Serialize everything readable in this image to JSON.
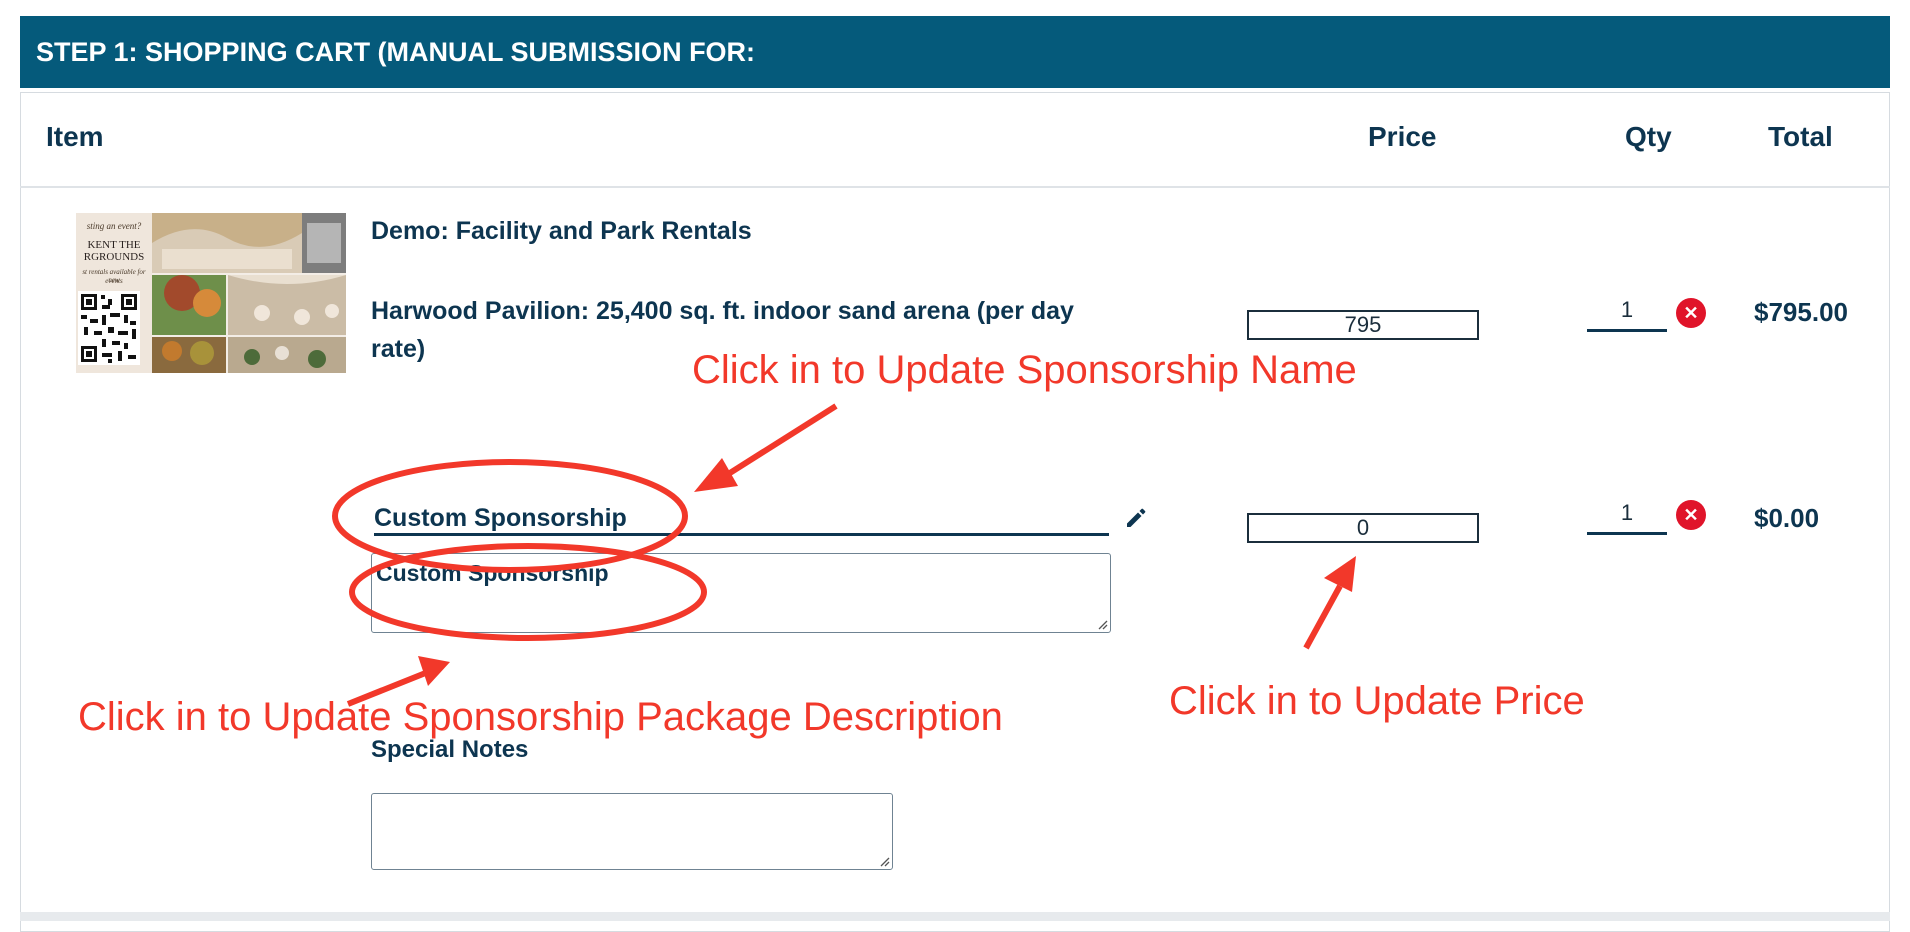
{
  "header": {
    "title": "STEP 1: SHOPPING CART (MANUAL SUBMISSION FOR:"
  },
  "table": {
    "columns": {
      "item": "Item",
      "price": "Price",
      "qty": "Qty",
      "total": "Total"
    }
  },
  "thumbnail": {
    "text_lines": [
      "sting an event?",
      "KENT THE",
      "RGROUNDS",
      "st rentals available for new",
      "events"
    ]
  },
  "cart": {
    "category": "Demo: Facility and Park Rentals",
    "item1": {
      "name": "Harwood Pavilion: 25,400 sq. ft. indoor sand arena (per day rate)",
      "price": "795",
      "qty": "1",
      "remove_icon": "close-icon",
      "total": "$795.00"
    },
    "item2": {
      "name": "Custom Sponsorship",
      "edit_icon": "pencil-icon",
      "description": "Custom Sponsorship",
      "price": "0",
      "qty": "1",
      "remove_icon": "close-icon",
      "total": "$0.00"
    },
    "special_notes_label": "Special Notes",
    "special_notes_value": ""
  },
  "annotations": {
    "name": "Click in to Update Sponsorship Name",
    "description": "Click in to Update Sponsorship Package Description",
    "price": "Click in to Update Price",
    "color": "#f2382a"
  },
  "colors": {
    "header_bg": "#055a7b",
    "text": "#0d3550",
    "remove": "#e0142a"
  }
}
